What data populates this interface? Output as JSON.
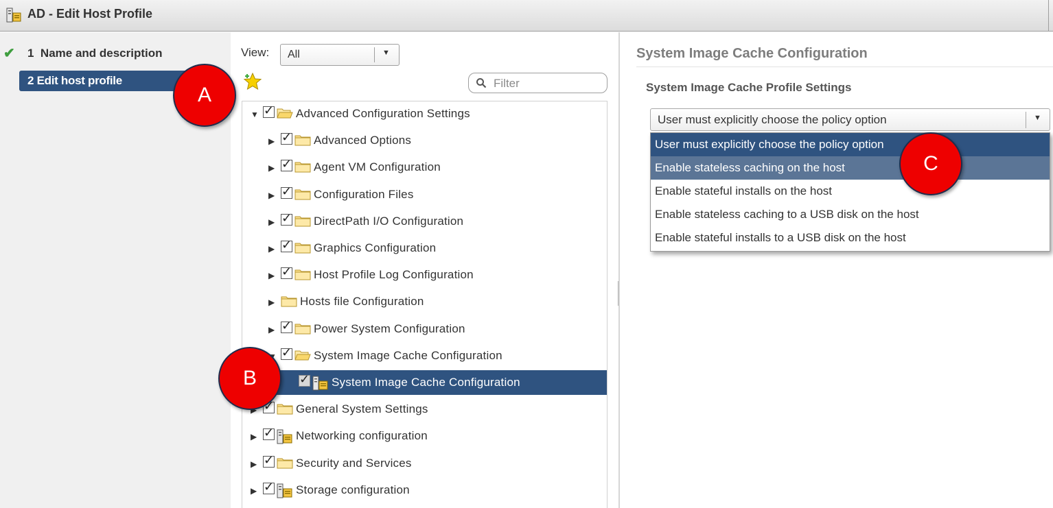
{
  "window": {
    "title": "AD - Edit Host Profile",
    "icon": "host-profile-icon"
  },
  "steps": [
    {
      "number": "1",
      "label": "Name and description",
      "status": "completed",
      "icon": "checkmark-icon"
    },
    {
      "number": "2",
      "label": "Edit host profile",
      "status": "active"
    }
  ],
  "toolbar": {
    "view_label": "View:",
    "view_value": "All",
    "filter_placeholder": "Filter",
    "favorites_icon": "star-icon"
  },
  "tree": [
    {
      "label": "Advanced Configuration Settings",
      "level": 0,
      "expanded": true,
      "checked": true,
      "icon": "folder-open-icon"
    },
    {
      "label": "Advanced Options",
      "level": 1,
      "expanded": false,
      "checked": true,
      "icon": "folder-icon"
    },
    {
      "label": "Agent VM Configuration",
      "level": 1,
      "expanded": false,
      "checked": true,
      "icon": "folder-icon"
    },
    {
      "label": "Configuration Files",
      "level": 1,
      "expanded": false,
      "checked": true,
      "icon": "folder-icon"
    },
    {
      "label": "DirectPath I/O Configuration",
      "level": 1,
      "expanded": false,
      "checked": true,
      "icon": "folder-icon"
    },
    {
      "label": "Graphics Configuration",
      "level": 1,
      "expanded": false,
      "checked": true,
      "icon": "folder-icon"
    },
    {
      "label": "Host Profile Log Configuration",
      "level": 1,
      "expanded": false,
      "checked": true,
      "icon": "folder-icon"
    },
    {
      "label": "Hosts file Configuration",
      "level": 1,
      "expanded": false,
      "checked": false,
      "icon": "folder-icon"
    },
    {
      "label": "Power System Configuration",
      "level": 1,
      "expanded": false,
      "checked": true,
      "icon": "folder-icon"
    },
    {
      "label": "System Image Cache Configuration",
      "level": 1,
      "expanded": true,
      "checked": true,
      "icon": "folder-open-icon"
    },
    {
      "label": "System Image Cache Configuration",
      "level": 2,
      "selected": true,
      "checked": true,
      "icon": "host-profile-icon"
    },
    {
      "label": "General System Settings",
      "level": 0,
      "expanded": false,
      "checked": true,
      "icon": "folder-icon"
    },
    {
      "label": "Networking configuration",
      "level": 0,
      "expanded": false,
      "checked": true,
      "icon": "host-profile-icon"
    },
    {
      "label": "Security and Services",
      "level": 0,
      "expanded": false,
      "checked": true,
      "icon": "folder-icon"
    },
    {
      "label": "Storage configuration",
      "level": 0,
      "expanded": false,
      "checked": true,
      "icon": "host-profile-icon"
    }
  ],
  "detail": {
    "title": "System Image Cache Configuration",
    "subtitle": "System Image Cache Profile Settings",
    "policy_value": "User must explicitly choose the policy option",
    "options": [
      "User must explicitly choose the policy option",
      "Enable stateless caching on the host",
      "Enable stateful installs on the host",
      "Enable stateless caching to a USB disk on the host",
      "Enable stateful installs to a USB disk on the host"
    ]
  },
  "callouts": [
    "A",
    "B",
    "C"
  ],
  "colors": {
    "selection": "#2f5380",
    "hover": "#5b7596",
    "callout": "#ee0000",
    "check": "#3f9e3f"
  }
}
